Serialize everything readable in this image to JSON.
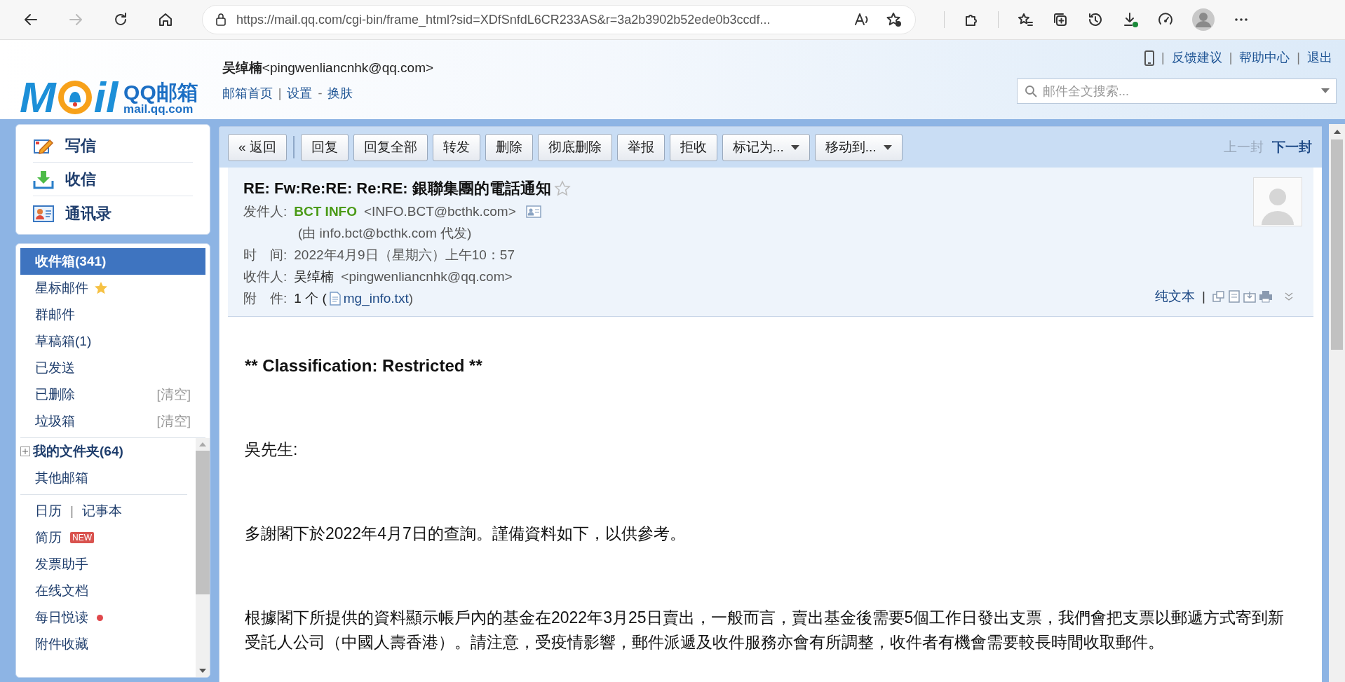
{
  "browser": {
    "url": "https://mail.qq.com/cgi-bin/frame_html?sid=XDfSnfdL6CR233AS&r=3a2b3902b52ede0b3ccdf...",
    "nav": [
      {
        "kind": "back",
        "disabled": false
      },
      {
        "kind": "forward",
        "disabled": true
      },
      {
        "kind": "refresh",
        "disabled": false
      },
      {
        "kind": "home",
        "disabled": false
      }
    ],
    "tools": [
      {
        "kind": "read-aloud"
      },
      {
        "kind": "favorite-add"
      },
      {
        "kind": "sep"
      },
      {
        "kind": "extensions"
      },
      {
        "kind": "sep"
      },
      {
        "kind": "favorites"
      },
      {
        "kind": "collections"
      },
      {
        "kind": "history"
      },
      {
        "kind": "downloads"
      },
      {
        "kind": "performance"
      },
      {
        "kind": "profile"
      },
      {
        "kind": "more"
      }
    ]
  },
  "header": {
    "logo": {
      "left": "M",
      "right": "il",
      "name": "QQ邮箱",
      "domain": "mail.qq.com"
    },
    "user_name": "吴绰楠",
    "user_email": "<pingwenliancnhk@qq.com>",
    "links": [
      {
        "kind": "link",
        "text": "邮箱首页"
      },
      {
        "kind": "sep",
        "text": "|"
      },
      {
        "kind": "link",
        "text": "设置"
      },
      {
        "kind": "sep",
        "text": "-"
      },
      {
        "kind": "link",
        "text": "换肤"
      }
    ],
    "top_links": [
      {
        "kind": "phone"
      },
      {
        "kind": "sep",
        "text": "|"
      },
      {
        "kind": "link",
        "text": "反馈建议"
      },
      {
        "kind": "sep",
        "text": "|"
      },
      {
        "kind": "link",
        "text": "帮助中心"
      },
      {
        "kind": "sep",
        "text": "|"
      },
      {
        "kind": "link",
        "text": "退出"
      }
    ],
    "search": {
      "placeholder": "邮件全文搜索..."
    }
  },
  "sidebar": {
    "actions": [
      {
        "kind": "compose",
        "label": "写信"
      },
      {
        "kind": "receive",
        "label": "收信"
      },
      {
        "kind": "contacts",
        "label": "通讯录"
      }
    ],
    "folders": [
      {
        "label": "收件箱(341)",
        "selected": true
      },
      {
        "label": "星标邮件",
        "selected": false,
        "kind": "starred"
      },
      {
        "label": "群邮件",
        "selected": false
      },
      {
        "label": "草稿箱(1)",
        "selected": false
      },
      {
        "label": "已发送",
        "selected": false
      },
      {
        "label": "已删除",
        "selected": false,
        "action": "[清空]"
      },
      {
        "label": "垃圾箱",
        "selected": false,
        "action": "[清空]"
      }
    ],
    "my_folders": {
      "label": "我的文件夹(64)",
      "expanded": false
    },
    "other": "其他邮箱",
    "tools": [
      {
        "kind": "pair",
        "items": [
          "日历",
          "记事本"
        ],
        "separator": "|"
      },
      {
        "kind": "badge",
        "label": "简历",
        "badge": "NEW"
      },
      {
        "kind": "plain",
        "label": "发票助手"
      },
      {
        "kind": "plain",
        "label": "在线文档"
      },
      {
        "kind": "dot",
        "label": "每日悦读"
      },
      {
        "kind": "plain",
        "label": "附件收藏"
      }
    ]
  },
  "toolbar": {
    "buttons": [
      {
        "label": "« 返回"
      },
      {
        "label": "回复",
        "divider": true
      },
      {
        "label": "回复全部"
      },
      {
        "label": "转发"
      },
      {
        "label": "删除"
      },
      {
        "label": "彻底删除"
      },
      {
        "label": "举报"
      },
      {
        "label": "拒收"
      },
      {
        "label": "标记为...",
        "menu": true
      },
      {
        "label": "移动到...",
        "menu": true
      }
    ],
    "nav": [
      {
        "label": "上一封",
        "disabled": true
      },
      {
        "label": "下一封",
        "disabled": false
      }
    ]
  },
  "mail": {
    "subject": "RE: Fw:Re:RE: Re:RE: 銀聯集團的電話通知",
    "starred": false,
    "from_label": "发件人:",
    "from_name": "BCT INFO",
    "from_email": "<INFO.BCT@bcthk.com>",
    "via": "(由 info.bct@bcthk.com 代发)",
    "time_label": "时　间:",
    "time": "2022年4月9日（星期六）上午10：57",
    "to_label": "收件人:",
    "to_name": "吴绰楠",
    "to_email": "<pingwenliancnhk@qq.com>",
    "attach_label": "附　件:",
    "attach_count": "1 个 (",
    "attach_file": "mg_info.txt",
    "attach_close": ")",
    "plain_text": "纯文本",
    "plain_sep": "|",
    "body": [
      {
        "kind": "heading",
        "text": "** Classification: Restricted **"
      },
      {
        "kind": "para",
        "text": "吳先生:"
      },
      {
        "kind": "para",
        "text": "多謝閣下於2022年4月7日的查詢。謹備資料如下，以供參考。"
      },
      {
        "kind": "para",
        "text": "根據閣下所提供的資料顯示帳戶內的基金在2022年3月25日賣出，一般而言，賣出基金後需要5個工作日發出支票，我們會把支票以郵遞方式寄到新受託人公司（中國人壽香港）。請注意，受疫情影響，郵件派遞及收件服務亦會有所調整，收件者有機會需要較長時間收取郵件。"
      }
    ]
  }
}
